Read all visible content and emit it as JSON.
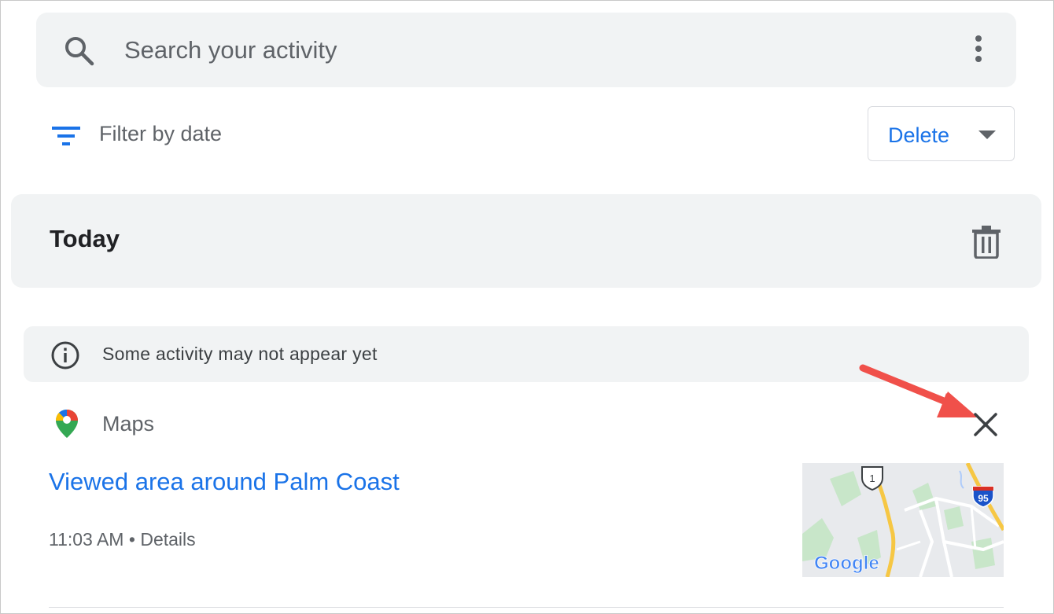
{
  "search": {
    "placeholder": "Search your activity"
  },
  "filter": {
    "label": "Filter by date"
  },
  "delete_menu": {
    "label": "Delete"
  },
  "day_group": {
    "label": "Today"
  },
  "notice": {
    "text": "Some activity may not appear yet"
  },
  "activity_item": {
    "product": "Maps",
    "title": "Viewed area around Palm Coast",
    "time": "11:03 AM",
    "separator": " • ",
    "details_link": "Details",
    "thumbnail": {
      "route_labels": [
        "1",
        "95"
      ],
      "watermark": "Google"
    }
  },
  "colors": {
    "accent": "#1a73e8",
    "surface": "#f1f3f4",
    "annotation_arrow": "#f0504a"
  }
}
